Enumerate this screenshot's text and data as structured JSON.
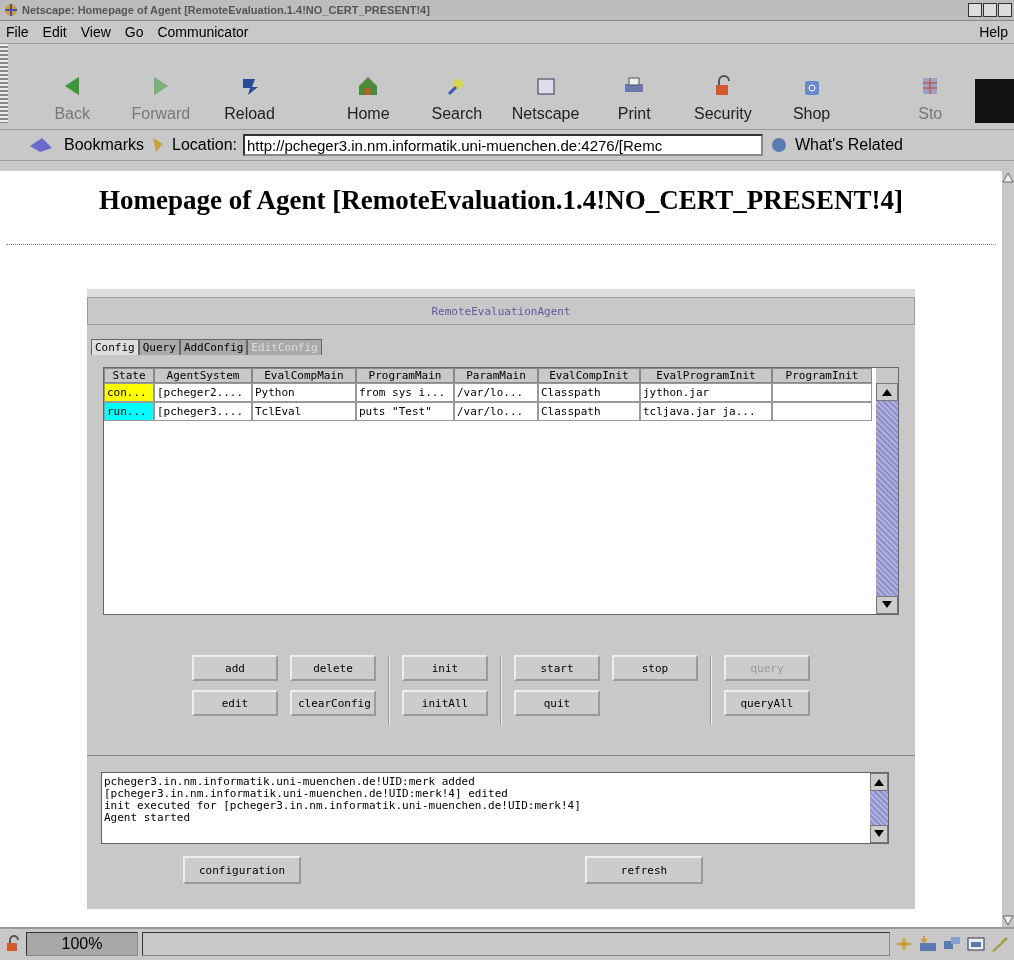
{
  "window": {
    "title": "Netscape: Homepage of Agent [RemoteEvaluation.1.4!NO_CERT_PRESENT!4]"
  },
  "menu": {
    "items": [
      "File",
      "Edit",
      "View",
      "Go",
      "Communicator"
    ],
    "help": "Help"
  },
  "toolbar": [
    {
      "label": "Back",
      "disabled": true
    },
    {
      "label": "Forward",
      "disabled": true
    },
    {
      "label": "Reload",
      "disabled": false
    },
    {
      "label": "Home",
      "disabled": false
    },
    {
      "label": "Search",
      "disabled": false
    },
    {
      "label": "Netscape",
      "disabled": false
    },
    {
      "label": "Print",
      "disabled": false
    },
    {
      "label": "Security",
      "disabled": false
    },
    {
      "label": "Shop",
      "disabled": false
    },
    {
      "label": "Sto",
      "disabled": true
    }
  ],
  "location_bar": {
    "bookmarks": "Bookmarks",
    "location_label": "Location:",
    "url": "http://pcheger3.in.nm.informatik.uni-muenchen.de:4276/[Remc",
    "whats_related": "What's Related"
  },
  "page": {
    "heading": "Homepage of Agent [RemoteEvaluation.1.4!NO_CERT_PRESENT!4]"
  },
  "applet": {
    "title": "RemoteEvaluationAgent",
    "tabs": [
      {
        "label": "Config",
        "selected": true,
        "disabled": false
      },
      {
        "label": "Query",
        "selected": false,
        "disabled": false
      },
      {
        "label": "AddConfig",
        "selected": false,
        "disabled": false
      },
      {
        "label": "EditConfig",
        "selected": false,
        "disabled": true
      }
    ],
    "table": {
      "columns": [
        "State",
        "AgentSystem",
        "EvalCompMain",
        "ProgramMain",
        "ParamMain",
        "EvalCompInit",
        "EvalProgramInit",
        "ProgramInit"
      ],
      "rows": [
        {
          "color": "#ffff00",
          "cells": [
            "con...",
            "[pcheger2....",
            "Python",
            "from sys i...",
            "/var/lo...",
            "Classpath",
            "jython.jar",
            ""
          ]
        },
        {
          "color": "#00ffff",
          "cells": [
            "run...",
            "[pcheger3....",
            "TclEval",
            "puts \"Test\"",
            "/var/lo...",
            "Classpath",
            "tcljava.jar ja...",
            ""
          ]
        }
      ]
    },
    "button_groups": [
      [
        {
          "label": "add",
          "disabled": false
        },
        {
          "label": "delete",
          "disabled": false
        },
        {
          "label": "edit",
          "disabled": false
        },
        {
          "label": "clearConfig",
          "disabled": false
        }
      ],
      [
        {
          "label": "init",
          "disabled": false
        },
        {
          "label": "initAll",
          "disabled": false
        }
      ],
      [
        {
          "label": "start",
          "disabled": false
        },
        {
          "label": "stop",
          "disabled": false
        },
        {
          "label": "quit",
          "disabled": false
        }
      ],
      [
        {
          "label": "query",
          "disabled": true
        },
        {
          "label": "queryAll",
          "disabled": false
        }
      ]
    ],
    "log": [
      "pcheger3.in.nm.informatik.uni-muenchen.de!UID:merk added",
      "[pcheger3.in.nm.informatik.uni-muenchen.de!UID:merk!4] edited",
      "init executed for [pcheger3.in.nm.informatik.uni-muenchen.de!UID:merk!4]",
      "Agent started"
    ],
    "bottom_buttons": [
      "configuration",
      "refresh"
    ]
  },
  "status_bar": {
    "zoom": "100%",
    "progress": {
      "level": 0
    }
  }
}
